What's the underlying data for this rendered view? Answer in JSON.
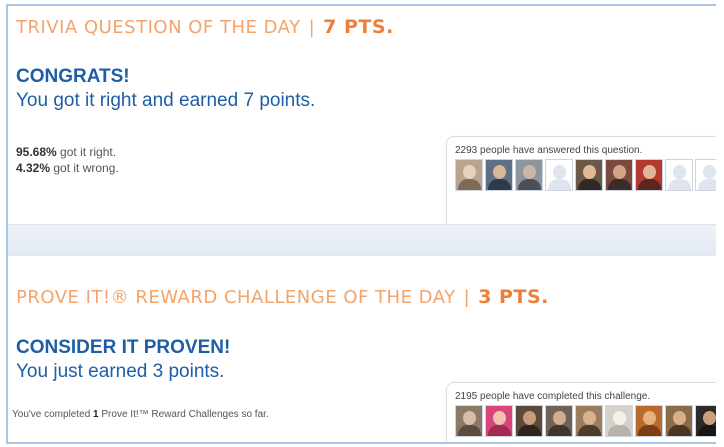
{
  "trivia": {
    "heading_text": "Trivia Question of the Day",
    "separator": "|",
    "points_label": "7 PTS.",
    "title": "CONGRATS!",
    "subtitle": "You got it right and earned 7 points.",
    "right_pct": "95.68%",
    "right_label": "got it right.",
    "wrong_pct": "4.32%",
    "wrong_label": "got it wrong.",
    "people_caption": "2293 people have answered this question.",
    "avatars": [
      {
        "kind": "photo",
        "bg": "#b9a58f",
        "head": "#e6d2bd",
        "torso": "#7f6a55"
      },
      {
        "kind": "photo",
        "bg": "#5f6f86",
        "head": "#d9b89a",
        "torso": "#2f3a48"
      },
      {
        "kind": "photo",
        "bg": "#8e959c",
        "head": "#c9b7a6",
        "torso": "#4b5058"
      },
      {
        "kind": "blank"
      },
      {
        "kind": "photo",
        "bg": "#6b5846",
        "head": "#e2b996",
        "torso": "#2f2a26"
      },
      {
        "kind": "photo",
        "bg": "#7a4a3f",
        "head": "#d8a285",
        "torso": "#3b2c2a"
      },
      {
        "kind": "photo",
        "bg": "#b23a2e",
        "head": "#e3b69a",
        "torso": "#5a2620"
      },
      {
        "kind": "blank"
      },
      {
        "kind": "blank"
      },
      {
        "kind": "photo",
        "bg": "#3d3d3d",
        "head": "#c39b7e",
        "torso": "#1d1d1d"
      }
    ]
  },
  "challenge": {
    "heading_text": "Prove It!® Reward Challenge of the Day",
    "separator": "|",
    "points_label": "3 PTS.",
    "title": "CONSIDER IT PROVEN!",
    "subtitle": "You just earned 3 points.",
    "note_prefix": "You've completed",
    "note_count": "1",
    "note_suffix": "Prove It!™ Reward Challenges so far.",
    "people_caption": "2195 people have completed this challenge.",
    "avatars": [
      {
        "kind": "photo",
        "bg": "#8c7a66",
        "head": "#d6bfa8",
        "torso": "#5b4b3d"
      },
      {
        "kind": "photo",
        "bg": "#d9447a",
        "head": "#f0c3b1",
        "torso": "#a22a55"
      },
      {
        "kind": "photo",
        "bg": "#5b4a3b",
        "head": "#c99a77",
        "torso": "#2e241d"
      },
      {
        "kind": "photo",
        "bg": "#6f6257",
        "head": "#d2ac8b",
        "torso": "#3d3530"
      },
      {
        "kind": "photo",
        "bg": "#9b7d5e",
        "head": "#d9b290",
        "torso": "#4e3c2b"
      },
      {
        "kind": "photo",
        "bg": "#d6d2cb",
        "head": "#f4f1ec",
        "torso": "#b8b2a9"
      },
      {
        "kind": "photo",
        "bg": "#b96a2c",
        "head": "#e6b17f",
        "torso": "#7a3f15"
      },
      {
        "kind": "photo",
        "bg": "#8a6b4a",
        "head": "#d9b08a",
        "torso": "#4a3622"
      },
      {
        "kind": "photo",
        "bg": "#2b2b2b",
        "head": "#caa07f",
        "torso": "#151515"
      },
      {
        "kind": "photo",
        "bg": "#7b8c5a",
        "head": "#d2b48f",
        "torso": "#3e4a2a"
      }
    ]
  }
}
